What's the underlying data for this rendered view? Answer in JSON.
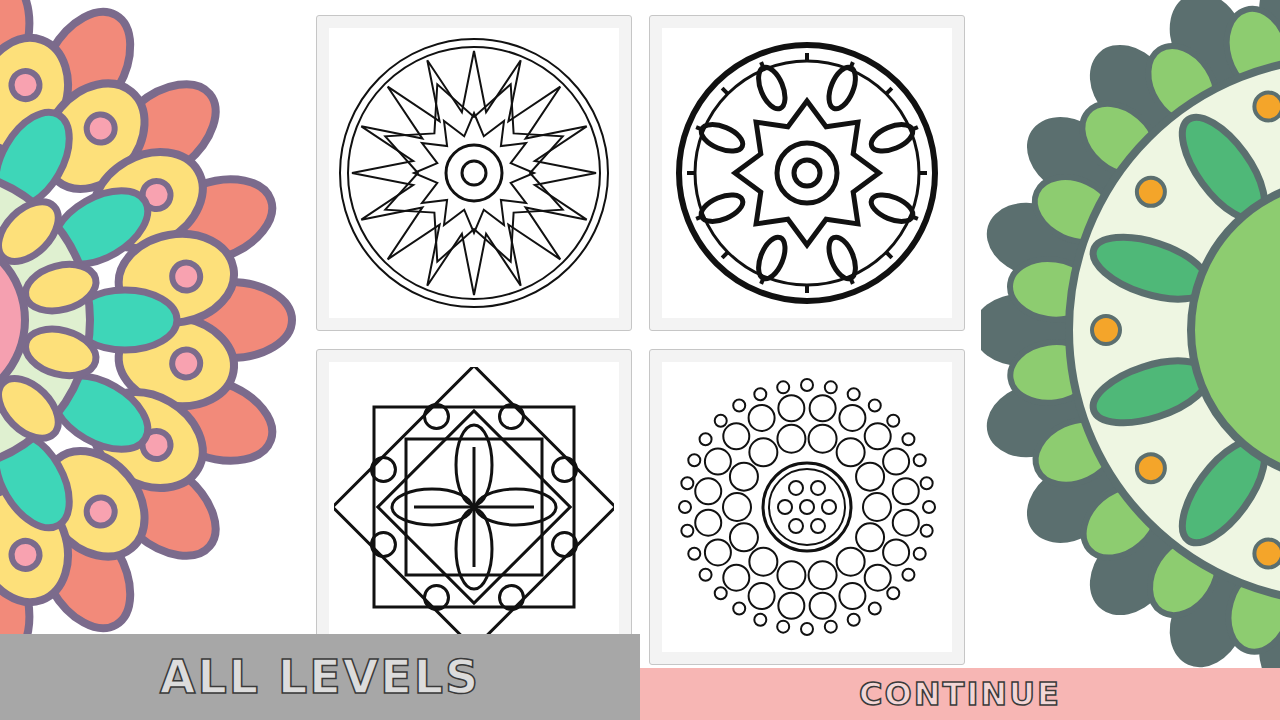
{
  "levels": [
    {
      "kind": "star"
    },
    {
      "kind": "flower"
    },
    {
      "kind": "lattice"
    },
    {
      "kind": "circles"
    }
  ],
  "all_levels_button": {
    "label": "ALL LEVELS"
  },
  "continue_button": {
    "label": "CONTINUE"
  }
}
